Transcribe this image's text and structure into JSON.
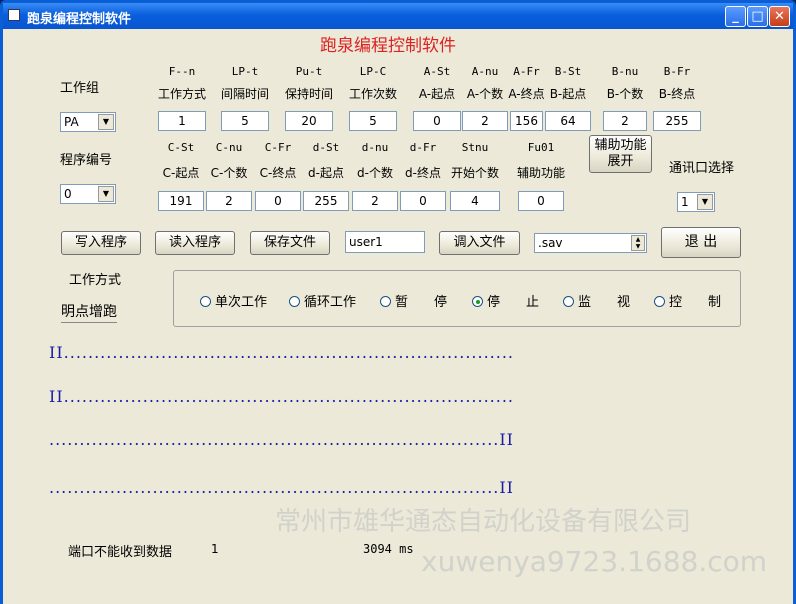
{
  "window": {
    "title": "跑泉编程控制软件",
    "header": "跑泉编程控制软件"
  },
  "left": {
    "group_label": "工作组",
    "group_value": "PA",
    "program_label": "程序编号",
    "program_value": "0"
  },
  "row1": [
    {
      "code": "F--n",
      "name": "工作方式",
      "value": "1"
    },
    {
      "code": "LP-t",
      "name": "间隔时间",
      "value": "5"
    },
    {
      "code": "Pu-t",
      "name": "保持时间",
      "value": "20"
    },
    {
      "code": "LP-C",
      "name": "工作次数",
      "value": "5"
    },
    {
      "code": "A-St",
      "name": "A-起点",
      "value": "0"
    },
    {
      "code": "A-nu",
      "name": "A-个数",
      "value": "2"
    },
    {
      "code": "A-Fr",
      "name": "A-终点",
      "value": "156"
    },
    {
      "code": "B-St",
      "name": "B-起点",
      "value": "64"
    },
    {
      "code": "B-nu",
      "name": "B-个数",
      "value": "2"
    },
    {
      "code": "B-Fr",
      "name": "B-终点",
      "value": "255"
    }
  ],
  "row2": [
    {
      "code": "C-St",
      "name": "C-起点",
      "value": "191"
    },
    {
      "code": "C-nu",
      "name": "C-个数",
      "value": "2"
    },
    {
      "code": "C-Fr",
      "name": "C-终点",
      "value": "0"
    },
    {
      "code": "d-St",
      "name": "d-起点",
      "value": "255"
    },
    {
      "code": "d-nu",
      "name": "d-个数",
      "value": "2"
    },
    {
      "code": "d-Fr",
      "name": "d-终点",
      "value": "0"
    },
    {
      "code": "Stnu",
      "name": "开始个数",
      "value": "4"
    },
    {
      "code": "Fu01",
      "name": "辅助功能",
      "value": "0"
    }
  ],
  "aux_button": {
    "line1": "辅助功能",
    "line2": "展开"
  },
  "comm": {
    "label": "通讯口选择",
    "value": "1"
  },
  "buttons": {
    "write": "写入程序",
    "read": "读入程序",
    "save": "保存文件",
    "load": "调入文件",
    "exit": "退 出"
  },
  "filename": "user1",
  "file_ext": ".sav",
  "mode": {
    "label": "工作方式",
    "current": "明点增跑",
    "options": [
      "单次工作",
      "循环工作",
      "暂　　停",
      "停　　止",
      "监　　视",
      "控　　制"
    ],
    "selected": "停　　止"
  },
  "lines": {
    "l1": "II..........................................................................",
    "l2": "II..........................................................................",
    "l3": "..........................................................................II",
    "l4": "..........................................................................II"
  },
  "status": {
    "message": "端口不能收到数据",
    "count": "1",
    "time": "3094 ms"
  },
  "watermark": {
    "line1": "常州市雄华通态自动化设备有限公司",
    "line2": "xuwenya9723.1688.com"
  }
}
